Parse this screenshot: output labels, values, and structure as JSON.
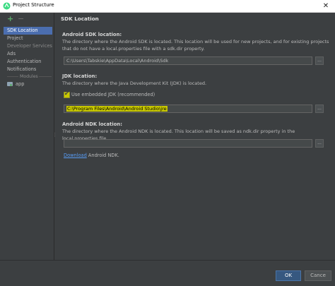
{
  "window": {
    "title": "Project Structure",
    "close_glyph": "✕"
  },
  "toolbar": {
    "add_glyph": "+",
    "remove_glyph": "−"
  },
  "sidebar": {
    "items": [
      {
        "label": "SDK Location"
      },
      {
        "label": "Project"
      },
      {
        "label": "Developer Services"
      },
      {
        "label": "Ads"
      },
      {
        "label": "Authentication"
      },
      {
        "label": "Notifications"
      }
    ],
    "modules_header": "Modules",
    "modules": [
      {
        "label": "app"
      }
    ]
  },
  "content": {
    "title": "SDK Location",
    "android_sdk": {
      "label": "Android SDK location:",
      "description": "The directory where the Android SDK is located. This location will be used for new projects, and for existing projects that do not have a local.properties file with a sdk.dir property.",
      "value": "C:\\Users\\Tabskie\\AppData\\Local\\Android\\Sdk"
    },
    "jdk": {
      "label": "JDK location:",
      "description": "The directory where the Java Development Kit (JDK) is located.",
      "checkbox_label": "Use embedded JDK (recommended)",
      "checkbox_checked": true,
      "value": "C:\\Program Files\\Android\\Android Studio\\jre"
    },
    "ndk": {
      "label": "Android NDK location:",
      "description": "The directory where the Android NDK is located. This location will be saved as ndk.dir property in the local.properties file.",
      "value": "",
      "download_link": "Download",
      "download_suffix": " Android NDK."
    },
    "browse_label": "..."
  },
  "footer": {
    "ok_label": "OK",
    "cancel_label": "Cance"
  },
  "colors": {
    "background": "#3c3f41",
    "selection": "#4b6eaf",
    "highlight": "#c8c800",
    "link": "#589df6"
  }
}
